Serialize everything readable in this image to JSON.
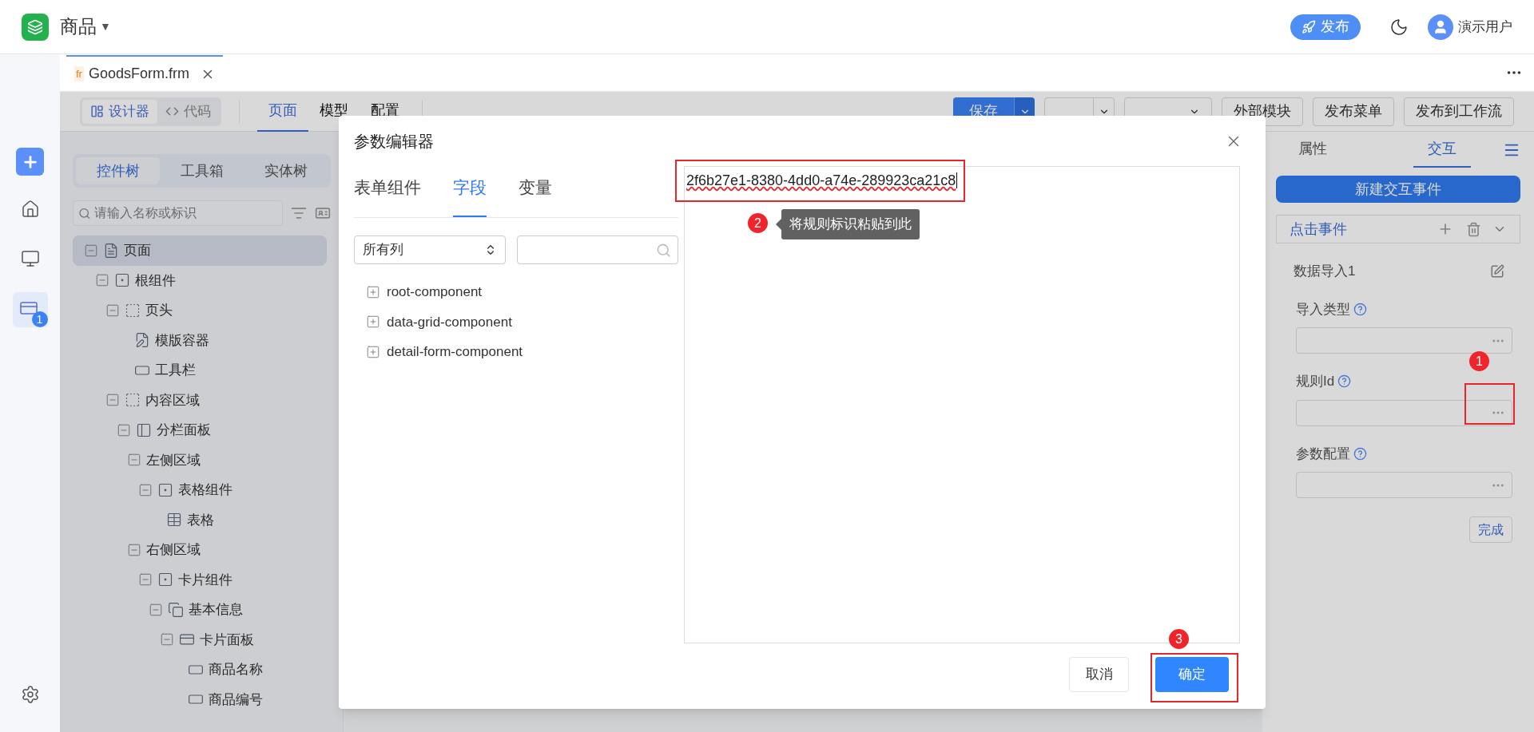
{
  "topbar": {
    "app_title": "商品",
    "dropdown_caret": "▼",
    "publish_button": "发布",
    "user_name": "演示用户"
  },
  "rail": {
    "badge": "1"
  },
  "file_tab": {
    "prefix": "fr",
    "name": "GoodsForm.frm"
  },
  "toolbar": {
    "view_modes": [
      {
        "label": "设计器",
        "selected": true
      },
      {
        "label": "代码",
        "selected": false
      }
    ],
    "tabs": [
      {
        "label": "页面",
        "selected": true
      },
      {
        "label": "模型",
        "selected": false
      },
      {
        "label": "配置",
        "selected": false
      }
    ],
    "buttons": [
      {
        "label": "保存",
        "kind": "primary-split"
      },
      {
        "kind": "split"
      },
      {
        "kind": "dropdown"
      },
      {
        "label": "外部模块",
        "kind": "plain"
      },
      {
        "label": "发布菜单",
        "kind": "plain"
      },
      {
        "label": "发布到工作流",
        "kind": "plain"
      }
    ]
  },
  "left_panel": {
    "tabs": [
      {
        "label": "控件树",
        "selected": true
      },
      {
        "label": "工具箱",
        "selected": false
      },
      {
        "label": "实体树",
        "selected": false
      }
    ],
    "search": {
      "placeholder": "请输入名称或标识"
    },
    "tree": [
      {
        "label": "页面",
        "kind": "page",
        "selected": true,
        "expanded": true,
        "children": [
          {
            "label": "根组件",
            "kind": "component",
            "selected": false,
            "expanded": true,
            "children": [
              {
                "label": "页头",
                "kind": "section",
                "selected": false,
                "expanded": true,
                "children": [
                  {
                    "label": "模版容器",
                    "kind": "template",
                    "selected": false
                  },
                  {
                    "label": "工具栏",
                    "kind": "toolbar",
                    "selected": false
                  }
                ]
              },
              {
                "label": "内容区域",
                "kind": "section",
                "selected": false,
                "expanded": true,
                "children": [
                  {
                    "label": "分栏面板",
                    "kind": "split",
                    "selected": false,
                    "expanded": true,
                    "children": [
                      {
                        "label": "左侧区域",
                        "selected": false,
                        "expanded": true,
                        "children": [
                          {
                            "label": "表格组件",
                            "kind": "component",
                            "selected": false,
                            "expanded": true,
                            "children": [
                              {
                                "label": "表格",
                                "kind": "table",
                                "selected": false
                              }
                            ]
                          }
                        ]
                      },
                      {
                        "label": "右侧区域",
                        "selected": false,
                        "expanded": true,
                        "children": [
                          {
                            "label": "卡片组件",
                            "kind": "component",
                            "selected": false,
                            "expanded": true,
                            "children": [
                              {
                                "label": "基本信息",
                                "kind": "group",
                                "selected": false,
                                "expanded": true,
                                "children": [
                                  {
                                    "label": "卡片面板",
                                    "kind": "panel",
                                    "selected": false,
                                    "expanded": true,
                                    "children": [
                                      {
                                        "label": "商品名称",
                                        "kind": "field",
                                        "selected": false
                                      },
                                      {
                                        "label": "商品编号",
                                        "kind": "field",
                                        "selected": false
                                      }
                                    ]
                                  }
                                ]
                              }
                            ]
                          }
                        ]
                      }
                    ]
                  }
                ]
              }
            ]
          }
        ]
      }
    ]
  },
  "right_panel": {
    "tabs": [
      {
        "label": "属性",
        "selected": false
      },
      {
        "label": "交互",
        "selected": true
      }
    ],
    "new_event_button": "新建交互事件",
    "event_title": "点击事件",
    "action": "数据导入1",
    "fields": [
      {
        "label": "导入类型"
      },
      {
        "label": "规则Id"
      },
      {
        "label": "参数配置"
      }
    ],
    "done_button": "完成"
  },
  "dialog": {
    "title": "参数编辑器",
    "tabs": [
      {
        "label": "表单组件",
        "selected": false
      },
      {
        "label": "字段",
        "selected": true
      },
      {
        "label": "变量",
        "selected": false
      }
    ],
    "column_select": "所有列",
    "tree": [
      {
        "label": "root-component",
        "expanded": false
      },
      {
        "label": "data-grid-component",
        "expanded": false
      },
      {
        "label": "detail-form-component",
        "expanded": false
      }
    ],
    "editor_value": "2f6b27e1-8380-4dd0-a74e-289923ca21c8",
    "tooltip": "将规则标识粘贴到此",
    "buttons": [
      {
        "label": "取消",
        "kind": "default"
      },
      {
        "label": "确定",
        "kind": "primary"
      }
    ]
  },
  "annotations": [
    {
      "number": "1"
    },
    {
      "number": "2"
    },
    {
      "number": "3"
    }
  ]
}
